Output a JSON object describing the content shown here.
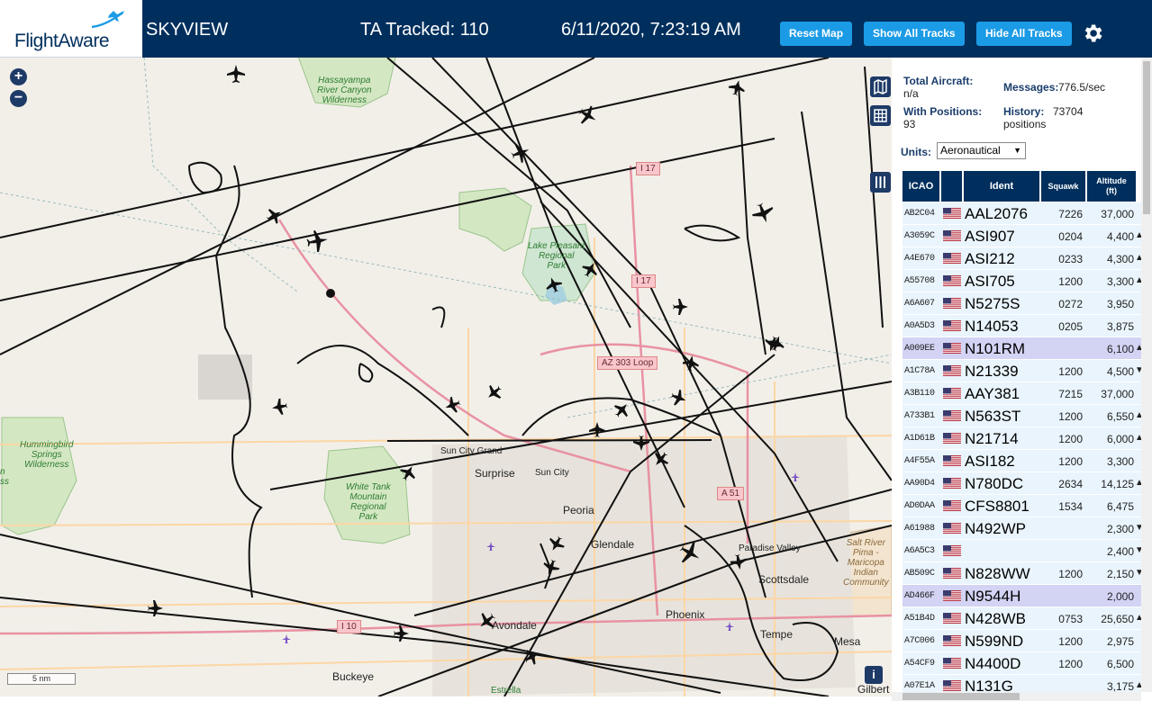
{
  "brand": {
    "name": "FlightAware"
  },
  "header": {
    "title": "SKYVIEW",
    "tracked": "TA Tracked: 110",
    "datetime": "6/11/2020, 7:23:19 AM",
    "buttons": {
      "reset": "Reset Map",
      "show_all": "Show All Tracks",
      "hide_all": "Hide All Tracks"
    },
    "settings_icon": "gear-icon"
  },
  "map": {
    "zoom_in": "+",
    "zoom_out": "−",
    "scale": "5 nm",
    "info": "i",
    "places": [
      "Surprise",
      "Sun City",
      "Sun City Grand",
      "Peoria",
      "Glendale",
      "Phoenix",
      "Scottsdale",
      "Paradise Valley",
      "Tempe",
      "Mesa",
      "Gilbert",
      "Buckeye",
      "Avondale",
      "Estrella"
    ],
    "parks": {
      "hassayampa": "Hassayampa\nRiver Canyon\nWilderness",
      "pleasant": "Lake Pleasant\nRegional\nPark",
      "white_tank": "White Tank\nMountain\nRegional\nPark",
      "hummingbird": "Hummingbird\nSprings\nWilderness",
      "salt_river": "Salt River\nPima -\nMaricopa\nIndian\nCommunity",
      "edge": "n\nss"
    },
    "highways": [
      "I 17",
      "I 17",
      "AZ 303 Loop",
      "I 10",
      "A 51"
    ]
  },
  "stats": {
    "total_label": "Total Aircraft:",
    "total_value": "n/a",
    "messages_label": "Messages:",
    "messages_value": "776.5/sec",
    "positions_label": "With Positions:",
    "positions_value": "93",
    "history_label": "History:",
    "history_value": "73704",
    "history_unit": "positions"
  },
  "units": {
    "label": "Units:",
    "selected": "Aeronautical"
  },
  "table": {
    "headers": {
      "icao": "ICAO",
      "ident": "Ident",
      "squawk": "Squawk",
      "altitude": "Altitude (ft)"
    },
    "rows": [
      {
        "icao": "AB2C04",
        "ident": "AAL2076",
        "squawk": "7226",
        "alt": "37,000",
        "trend": ""
      },
      {
        "icao": "A3059C",
        "ident": "ASI907",
        "squawk": "0204",
        "alt": "4,400",
        "trend": "▲"
      },
      {
        "icao": "A4E670",
        "ident": "ASI212",
        "squawk": "0233",
        "alt": "4,300",
        "trend": "▲"
      },
      {
        "icao": "A55708",
        "ident": "ASI705",
        "squawk": "1200",
        "alt": "3,300",
        "trend": "▲"
      },
      {
        "icao": "A6A607",
        "ident": "N5275S",
        "squawk": "0272",
        "alt": "3,950",
        "trend": ""
      },
      {
        "icao": "A0A5D3",
        "ident": "N14053",
        "squawk": "0205",
        "alt": "3,875",
        "trend": ""
      },
      {
        "icao": "A009EE",
        "ident": "N101RM",
        "squawk": "",
        "alt": "6,100",
        "trend": "▲",
        "sel": true
      },
      {
        "icao": "A1C78A",
        "ident": "N21339",
        "squawk": "1200",
        "alt": "4,500",
        "trend": "▼"
      },
      {
        "icao": "A3B110",
        "ident": "AAY381",
        "squawk": "7215",
        "alt": "37,000",
        "trend": ""
      },
      {
        "icao": "A733B1",
        "ident": "N563ST",
        "squawk": "1200",
        "alt": "6,550",
        "trend": "▲"
      },
      {
        "icao": "A1D61B",
        "ident": "N21714",
        "squawk": "1200",
        "alt": "6,000",
        "trend": "▲"
      },
      {
        "icao": "A4F55A",
        "ident": "ASI182",
        "squawk": "1200",
        "alt": "3,300",
        "trend": ""
      },
      {
        "icao": "AA90D4",
        "ident": "N780DC",
        "squawk": "2634",
        "alt": "14,125",
        "trend": "▲"
      },
      {
        "icao": "AD0DAA",
        "ident": "CFS8801",
        "squawk": "1534",
        "alt": "6,475",
        "trend": ""
      },
      {
        "icao": "A61988",
        "ident": "N492WP",
        "squawk": "",
        "alt": "2,300",
        "trend": "▼"
      },
      {
        "icao": "A6A5C3",
        "ident": "",
        "squawk": "",
        "alt": "2,400",
        "trend": "▼"
      },
      {
        "icao": "AB509C",
        "ident": "N828WW",
        "squawk": "1200",
        "alt": "2,150",
        "trend": "▼"
      },
      {
        "icao": "AD466F",
        "ident": "N9544H",
        "squawk": "",
        "alt": "2,000",
        "trend": "",
        "sel": true
      },
      {
        "icao": "A51B4D",
        "ident": "N428WB",
        "squawk": "0753",
        "alt": "25,650",
        "trend": "▲"
      },
      {
        "icao": "A7C006",
        "ident": "N599ND",
        "squawk": "1200",
        "alt": "2,975",
        "trend": ""
      },
      {
        "icao": "A54CF9",
        "ident": "N4400D",
        "squawk": "1200",
        "alt": "6,500",
        "trend": ""
      },
      {
        "icao": "A07E1A",
        "ident": "N131G",
        "squawk": "",
        "alt": "3,175",
        "trend": "▲"
      }
    ]
  }
}
